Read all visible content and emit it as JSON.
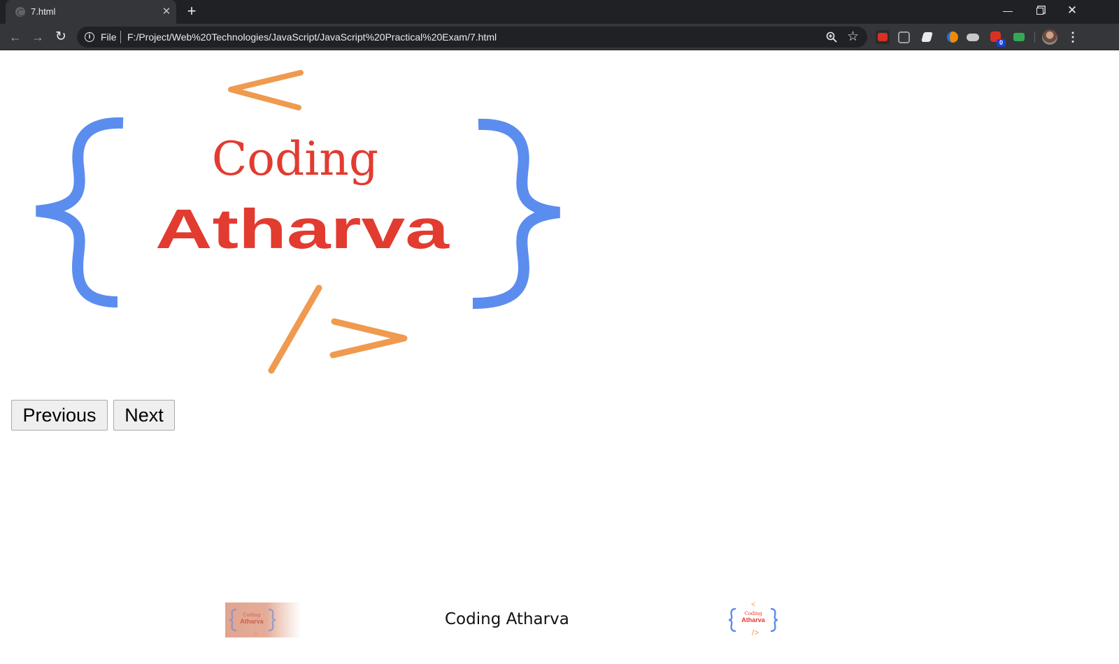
{
  "browser": {
    "tab_title": "7.html",
    "scheme_label": "File",
    "url": "F:/Project/Web%20Technologies/JavaScript/JavaScript%20Practical%20Exam/7.html",
    "extension_badge": "0"
  },
  "logo": {
    "line1": "Coding",
    "line2": "Atharva",
    "open_tag": "<",
    "close_tag": "/>",
    "colors": {
      "brace": "#5b8def",
      "coding": "#e23b30",
      "atharva": "#e23b30",
      "tag": "#ef9a4f"
    }
  },
  "buttons": {
    "previous": "Previous",
    "next": "Next"
  },
  "footer": {
    "caption": "Coding Atharva"
  }
}
